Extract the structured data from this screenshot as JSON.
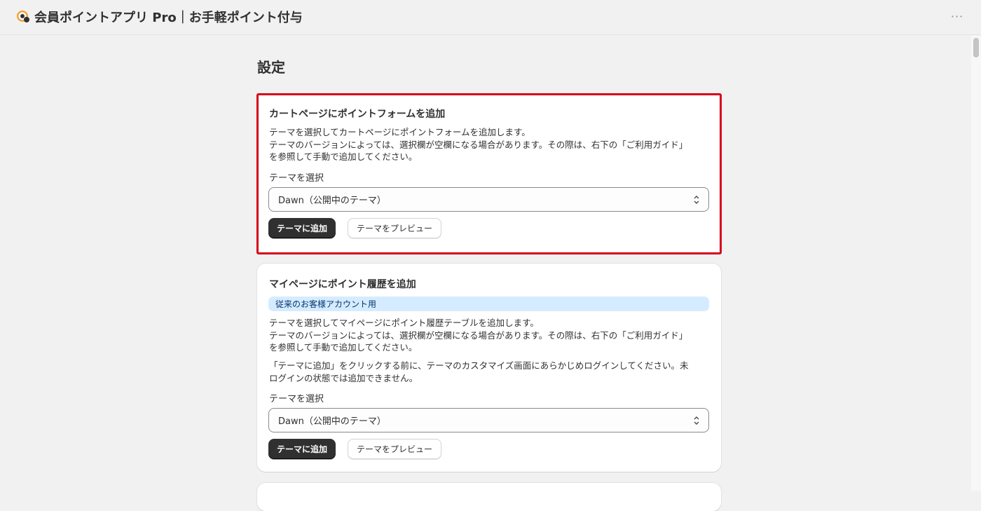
{
  "header": {
    "title": "会員ポイントアプリ Pro｜お手軽ポイント付与",
    "more_label": "···"
  },
  "page": {
    "title": "設定"
  },
  "cards": [
    {
      "title": "カートページにポイントフォームを追加",
      "description": [
        "テーマを選択してカートページにポイントフォームを追加します。",
        "テーマのバージョンによっては、選択欄が空欄になる場合があります。その際は、右下の「ご利用ガイド」",
        "を参照して手動で追加してください。"
      ],
      "select_label": "テーマを選択",
      "select_value": "Dawn（公開中のテーマ）",
      "primary_button": "テーマに追加",
      "secondary_button": "テーマをプレビュー",
      "highlighted": true
    },
    {
      "title": "マイページにポイント履歴を追加",
      "badge": "従来のお客様アカウント用",
      "description": [
        "テーマを選択してマイページにポイント履歴テーブルを追加します。",
        "テーマのバージョンによっては、選択欄が空欄になる場合があります。その際は、右下の「ご利用ガイド」",
        "を参照して手動で追加してください。"
      ],
      "note": [
        "「テーマに追加」をクリックする前に、テーマのカスタマイズ画面にあらかじめログインしてください。未",
        "ログインの状態では追加できません。"
      ],
      "select_label": "テーマを選択",
      "select_value": "Dawn（公開中のテーマ）",
      "primary_button": "テーマに追加",
      "secondary_button": "テーマをプレビュー"
    }
  ],
  "colors": {
    "highlight_border": "#d6001c",
    "primary_button_bg": "#303030",
    "badge_bg": "#d5ebff"
  },
  "icons": [
    "app-logo-icon",
    "more-horizontal-icon",
    "select-arrows-icon"
  ]
}
